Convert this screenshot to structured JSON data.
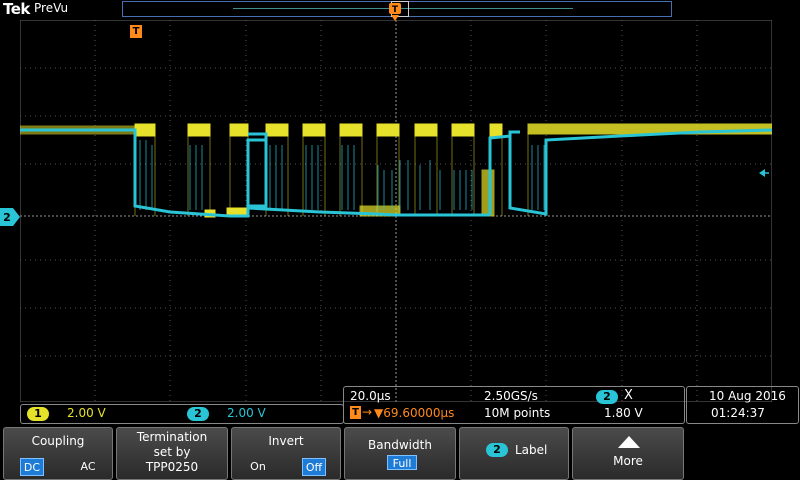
{
  "header": {
    "brand": "Tek",
    "mode": "PreVu"
  },
  "markers": {
    "trigger_letter": "T",
    "channel_marker": "2"
  },
  "status": {
    "ch1_badge": "1",
    "ch1_scale": "2.00 V",
    "ch2_badge": "2",
    "ch2_scale": "2.00 V",
    "timebase": "20.0µs",
    "sample_rate": "2.50GS/s",
    "trig_channel": "2",
    "trig_symbol": "X",
    "trig_delay": "▼69.60000µs",
    "record_length": "10M points",
    "trig_level": "1.80 V",
    "date": "10 Aug 2016",
    "time": "01:24:37"
  },
  "softkeys": {
    "coupling": {
      "label": "Coupling",
      "dc": "DC",
      "ac": "AC",
      "selected": "DC"
    },
    "termination": {
      "line1": "Termination",
      "line2": "set by",
      "line3": "TPP0250"
    },
    "invert": {
      "label": "Invert",
      "on": "On",
      "off": "Off",
      "selected": "Off"
    },
    "bandwidth": {
      "label": "Bandwidth",
      "value": "Full"
    },
    "label": {
      "badge": "2",
      "text": "Label"
    },
    "more": {
      "text": "More"
    }
  },
  "colors": {
    "ch1": "#e6e12a",
    "ch2": "#29c4d6",
    "trigger": "#ff8a1c",
    "grid": "#555555",
    "background": "#000000"
  }
}
